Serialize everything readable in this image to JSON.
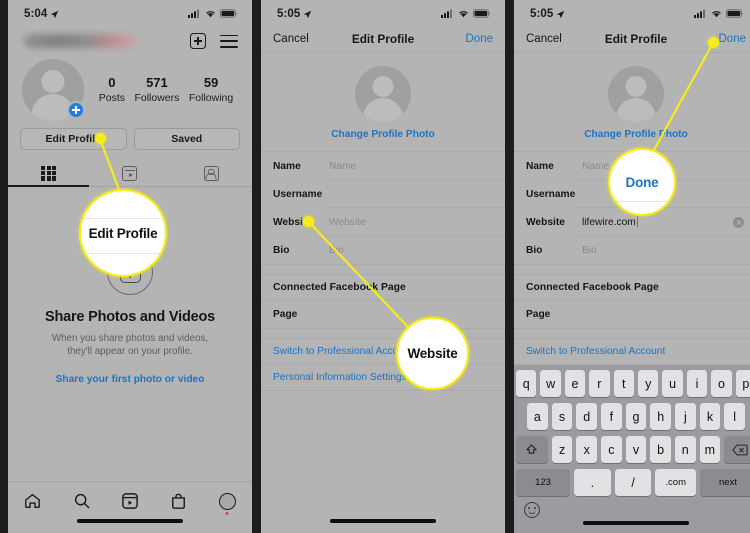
{
  "panel1": {
    "status": {
      "time": "5:04",
      "location_icon": "location-arrow-icon",
      "signal_icon": "cellular-signal-icon",
      "wifi_icon": "wifi-icon",
      "battery_icon": "battery-icon"
    },
    "username_blurred": "",
    "add_icon": "plus-box-icon",
    "menu_icon": "hamburger-menu-icon",
    "avatar_badge_icon": "add-story-plus-icon",
    "stats": [
      {
        "num": "0",
        "label": "Posts"
      },
      {
        "num": "571",
        "label": "Followers"
      },
      {
        "num": "59",
        "label": "Following"
      }
    ],
    "buttons": {
      "edit_profile": "Edit Profile",
      "saved": "Saved"
    },
    "tabs": [
      {
        "icon": "grid-icon",
        "name": "grid-tab"
      },
      {
        "icon": "reels-icon",
        "name": "reels-tab"
      },
      {
        "icon": "tagged-icon",
        "name": "tagged-tab"
      }
    ],
    "empty_state": {
      "plus_icon": "add-post-plus-icon",
      "title": "Share Photos and Videos",
      "subtitle": "When you share photos and videos, they'll appear on your profile.",
      "link": "Share your first photo or video"
    },
    "bottom_tabs": [
      {
        "icon": "home-icon",
        "name": "tab-home"
      },
      {
        "icon": "search-icon",
        "name": "tab-search"
      },
      {
        "icon": "reels-icon",
        "name": "tab-reels"
      },
      {
        "icon": "shop-bag-icon",
        "name": "tab-shop"
      },
      {
        "icon": "profile-avatar-icon",
        "name": "tab-profile"
      }
    ]
  },
  "panel2": {
    "status": {
      "time": "5:05"
    },
    "nav": {
      "cancel": "Cancel",
      "title": "Edit Profile",
      "done": "Done"
    },
    "change_photo": "Change Profile Photo",
    "fields": [
      {
        "label": "Name",
        "value": "",
        "placeholder": "Name"
      },
      {
        "label": "Username",
        "value": "",
        "placeholder": ""
      },
      {
        "label": "Website",
        "value": "",
        "placeholder": "Website"
      },
      {
        "label": "Bio",
        "value": "",
        "placeholder": "Bio"
      }
    ],
    "section_title": "Connected Facebook Page",
    "page_row": "Page",
    "links": [
      "Switch to Professional Account",
      "Personal Information Settings"
    ]
  },
  "panel3": {
    "status": {
      "time": "5:05"
    },
    "nav": {
      "cancel": "Cancel",
      "title": "Edit Profile",
      "done": "Done"
    },
    "change_photo": "Change Profile Photo",
    "fields": [
      {
        "label": "Name",
        "value": "",
        "placeholder": "Name"
      },
      {
        "label": "Username",
        "value": "",
        "placeholder": ""
      },
      {
        "label": "Website",
        "value": "lifewire.com",
        "placeholder": "Website"
      },
      {
        "label": "Bio",
        "value": "",
        "placeholder": "Bio"
      }
    ],
    "section_title": "Connected Facebook Page",
    "page_row": "Page",
    "links": [
      "Switch to Professional Account"
    ],
    "keyboard": {
      "row1": [
        "q",
        "w",
        "e",
        "r",
        "t",
        "y",
        "u",
        "i",
        "o",
        "p"
      ],
      "row2": [
        "a",
        "s",
        "d",
        "f",
        "g",
        "h",
        "j",
        "k",
        "l"
      ],
      "row3": [
        "z",
        "x",
        "c",
        "v",
        "b",
        "n",
        "m"
      ],
      "shift_icon": "shift-arrow-icon",
      "backspace_icon": "backspace-delete-icon",
      "numbers_key": "123",
      "period_key": ".",
      "slash_key": "/",
      "dotcom_key": ".com",
      "next_key": "next",
      "emoji_icon": "emoji-smiley-icon"
    }
  },
  "callouts": [
    {
      "text": "Edit Profile",
      "target": "edit-profile-button"
    },
    {
      "text": "Website",
      "target": "website-field"
    },
    {
      "text": "Done",
      "target": "done-button"
    }
  ],
  "colors": {
    "accent_yellow": "#f5ec1d",
    "link_blue": "#1b74c4",
    "panel_bg": "#b4b4b4",
    "frame": "#1c1c1c"
  }
}
